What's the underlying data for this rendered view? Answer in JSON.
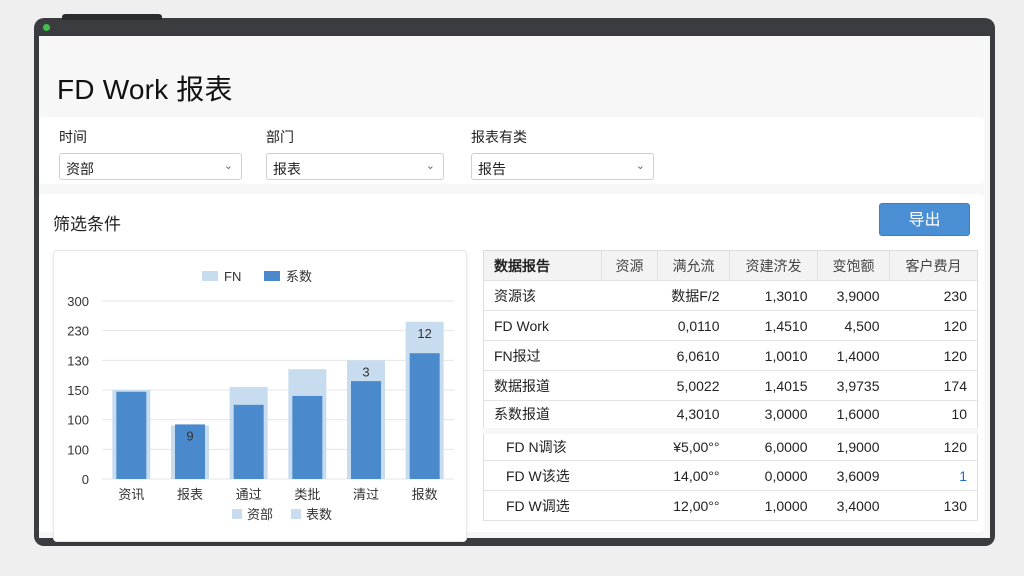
{
  "window": {
    "title": "FD Work 报表"
  },
  "filters": [
    {
      "label": "时间",
      "value": "资部"
    },
    {
      "label": "部门",
      "value": "报表"
    },
    {
      "label": "报表有类",
      "value": "报告"
    }
  ],
  "panel": {
    "title": "筛选条件",
    "export_label": "导出"
  },
  "chart_data": {
    "type": "bar",
    "categories": [
      "资讯",
      "报表",
      "通过",
      "类批",
      "清过",
      "报数"
    ],
    "series": [
      {
        "name": "FN",
        "values": [
          150,
          90,
          155,
          185,
          200,
          265
        ]
      },
      {
        "name": "系数",
        "values": [
          147,
          92,
          125,
          140,
          165,
          212
        ]
      }
    ],
    "ytick_labels": [
      "0",
      "100",
      "100",
      "150",
      "130",
      "230",
      "300"
    ],
    "data_labels": [
      "",
      "9",
      "",
      "",
      "3",
      "12"
    ],
    "legend_top": [
      "FN",
      "系数"
    ],
    "legend_bottom": [
      "资部",
      "表数"
    ],
    "ylim": [
      0,
      300
    ],
    "colors": {
      "light": "#c8dcef",
      "dark": "#4a8acc"
    }
  },
  "table": {
    "headers": [
      "数据报告",
      "资源",
      "满允流",
      "资建济发",
      "变饱额",
      "客户费月"
    ],
    "rows": [
      [
        "资源该",
        "数据F/2",
        "1,3010",
        "3,9000",
        "230"
      ],
      [
        "FD Work",
        "0,0110",
        "1,4510",
        "4,500",
        "120"
      ],
      [
        "FN报过",
        "6,0610",
        "1,0010",
        "1,4000",
        "120"
      ],
      [
        "数据报道",
        "5,0022",
        "1,4015",
        "3,9735",
        "174"
      ],
      [
        "系数报道",
        "4,3010",
        "3,0000",
        "1,6000",
        "10"
      ]
    ],
    "rows2": [
      [
        "FD N调该",
        "¥5,00°°",
        "6,0000",
        "1,9000",
        "120"
      ],
      [
        "FD W该选",
        "14,00°°",
        "0,0000",
        "3,6009",
        "1"
      ],
      [
        "FD W调选",
        "12,00°°",
        "1,0000",
        "3,4000",
        "130"
      ]
    ]
  }
}
